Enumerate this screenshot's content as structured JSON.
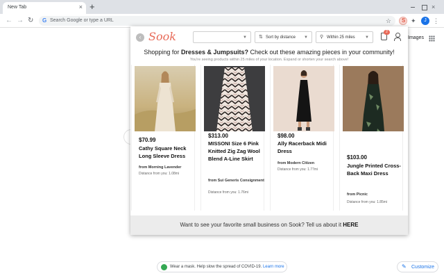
{
  "browser": {
    "tab_title": "New Tab",
    "close_glyph": "×",
    "new_tab_glyph": "+",
    "omnibox_placeholder": "Search Google or type a URL",
    "profile_initial": "J",
    "icons": [
      "back-icon",
      "forward-icon",
      "reload-icon",
      "google-icon",
      "star-icon",
      "sook-extension-icon",
      "puzzle-icon",
      "profile-avatar",
      "menu-icon"
    ]
  },
  "ntp": {
    "images_link": "Images",
    "mask_message": "Wear a mask. Help slow the spread of COVID-19.",
    "mask_link": "Learn more",
    "customize_label": "Customize"
  },
  "sook": {
    "logo": "Sook",
    "brand_color": "#e86a58",
    "category_select": "",
    "sort_select": "Sort by distance",
    "radius_select": "Within 25 miles",
    "cart_count": "2",
    "headline_prefix": "Shopping for ",
    "headline_category": "Dresses & Jumpsuits?",
    "headline_suffix": " Check out these amazing pieces in your community!",
    "subline": "You're seeing products within 25 miles of your location. Expand or shorten your search above!",
    "products": [
      {
        "price": "$70.99",
        "title": "Cathy Square Neck Long Sleeve Dress",
        "shop": "from Morning Lavender",
        "distance": "Distance from you: 1.08mi"
      },
      {
        "price": "$313.00",
        "title": "MISSONI Size 6 Pink Knitted Zig Zag Wool Blend A-Line Skirt",
        "shop": "from Sui Generis Consignment",
        "distance": "Distance from you: 1.76mi"
      },
      {
        "price": "$98.00",
        "title": "Ally Racerback Midi Dress",
        "shop": "from Modern Citizen",
        "distance": "Distance from you: 1.77mi"
      },
      {
        "price": "$103.00",
        "title": "Jungle Printed Cross-Back Maxi Dress",
        "shop": "from Picnic",
        "distance": "Distance from you: 1.85mi"
      }
    ],
    "footer_text": "Want to see your favorite small business on Sook? Tell us about it ",
    "footer_link": "HERE"
  }
}
